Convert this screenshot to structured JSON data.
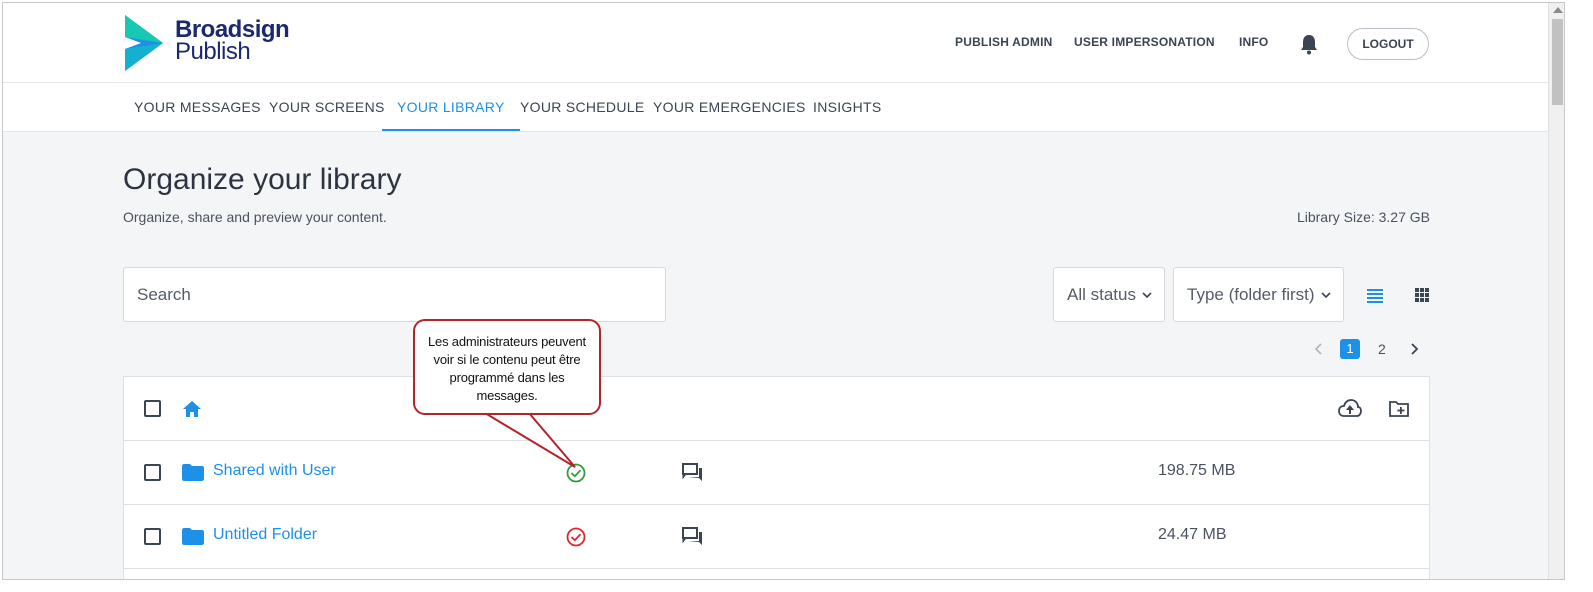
{
  "brand": {
    "name_line1": "Broadsign",
    "name_line2": "Publish",
    "logo_colors": [
      "#17c9b5",
      "#1e90e6"
    ]
  },
  "topnav": {
    "items": [
      "PUBLISH ADMIN",
      "USER IMPERSONATION",
      "INFO"
    ],
    "logout_label": "LOGOUT"
  },
  "tabs": [
    {
      "label": "YOUR MESSAGES",
      "active": false
    },
    {
      "label": "YOUR SCREENS",
      "active": false
    },
    {
      "label": "YOUR LIBRARY",
      "active": true
    },
    {
      "label": "YOUR SCHEDULE",
      "active": false
    },
    {
      "label": "YOUR EMERGENCIES",
      "active": false
    },
    {
      "label": "INSIGHTS",
      "active": false
    }
  ],
  "page": {
    "title": "Organize your library",
    "subtitle": "Organize, share and preview your content.",
    "library_size": "Library Size: 3.27 GB"
  },
  "search": {
    "placeholder": "Search",
    "value": ""
  },
  "filters": {
    "status_label": "All status",
    "sort_label": "Type (folder first)"
  },
  "pagination": {
    "current": "1",
    "next_page": "2",
    "total_pages": 2
  },
  "table": {
    "rows": [
      {
        "name": "Shared with User",
        "status": "schedulable",
        "status_color": "#2e9d3a",
        "size": "198.75 MB"
      },
      {
        "name": "Untitled Folder",
        "status": "not-schedulable",
        "status_color": "#e0262d",
        "size": "24.47 MB"
      }
    ]
  },
  "callout": {
    "text": "Les administrateurs peuvent voir si le contenu peut être programmé dans les messages.",
    "border_color": "#b3252b"
  },
  "colors": {
    "accent": "#1e90e6",
    "text": "#3b4452"
  },
  "icons": [
    "bell-icon",
    "home-icon",
    "folder-icon",
    "check-circle-icon",
    "messages-icon",
    "upload-cloud-icon",
    "new-folder-icon",
    "list-view-icon",
    "grid-view-icon",
    "chevron-down-icon",
    "chevron-left-icon",
    "chevron-right-icon"
  ]
}
